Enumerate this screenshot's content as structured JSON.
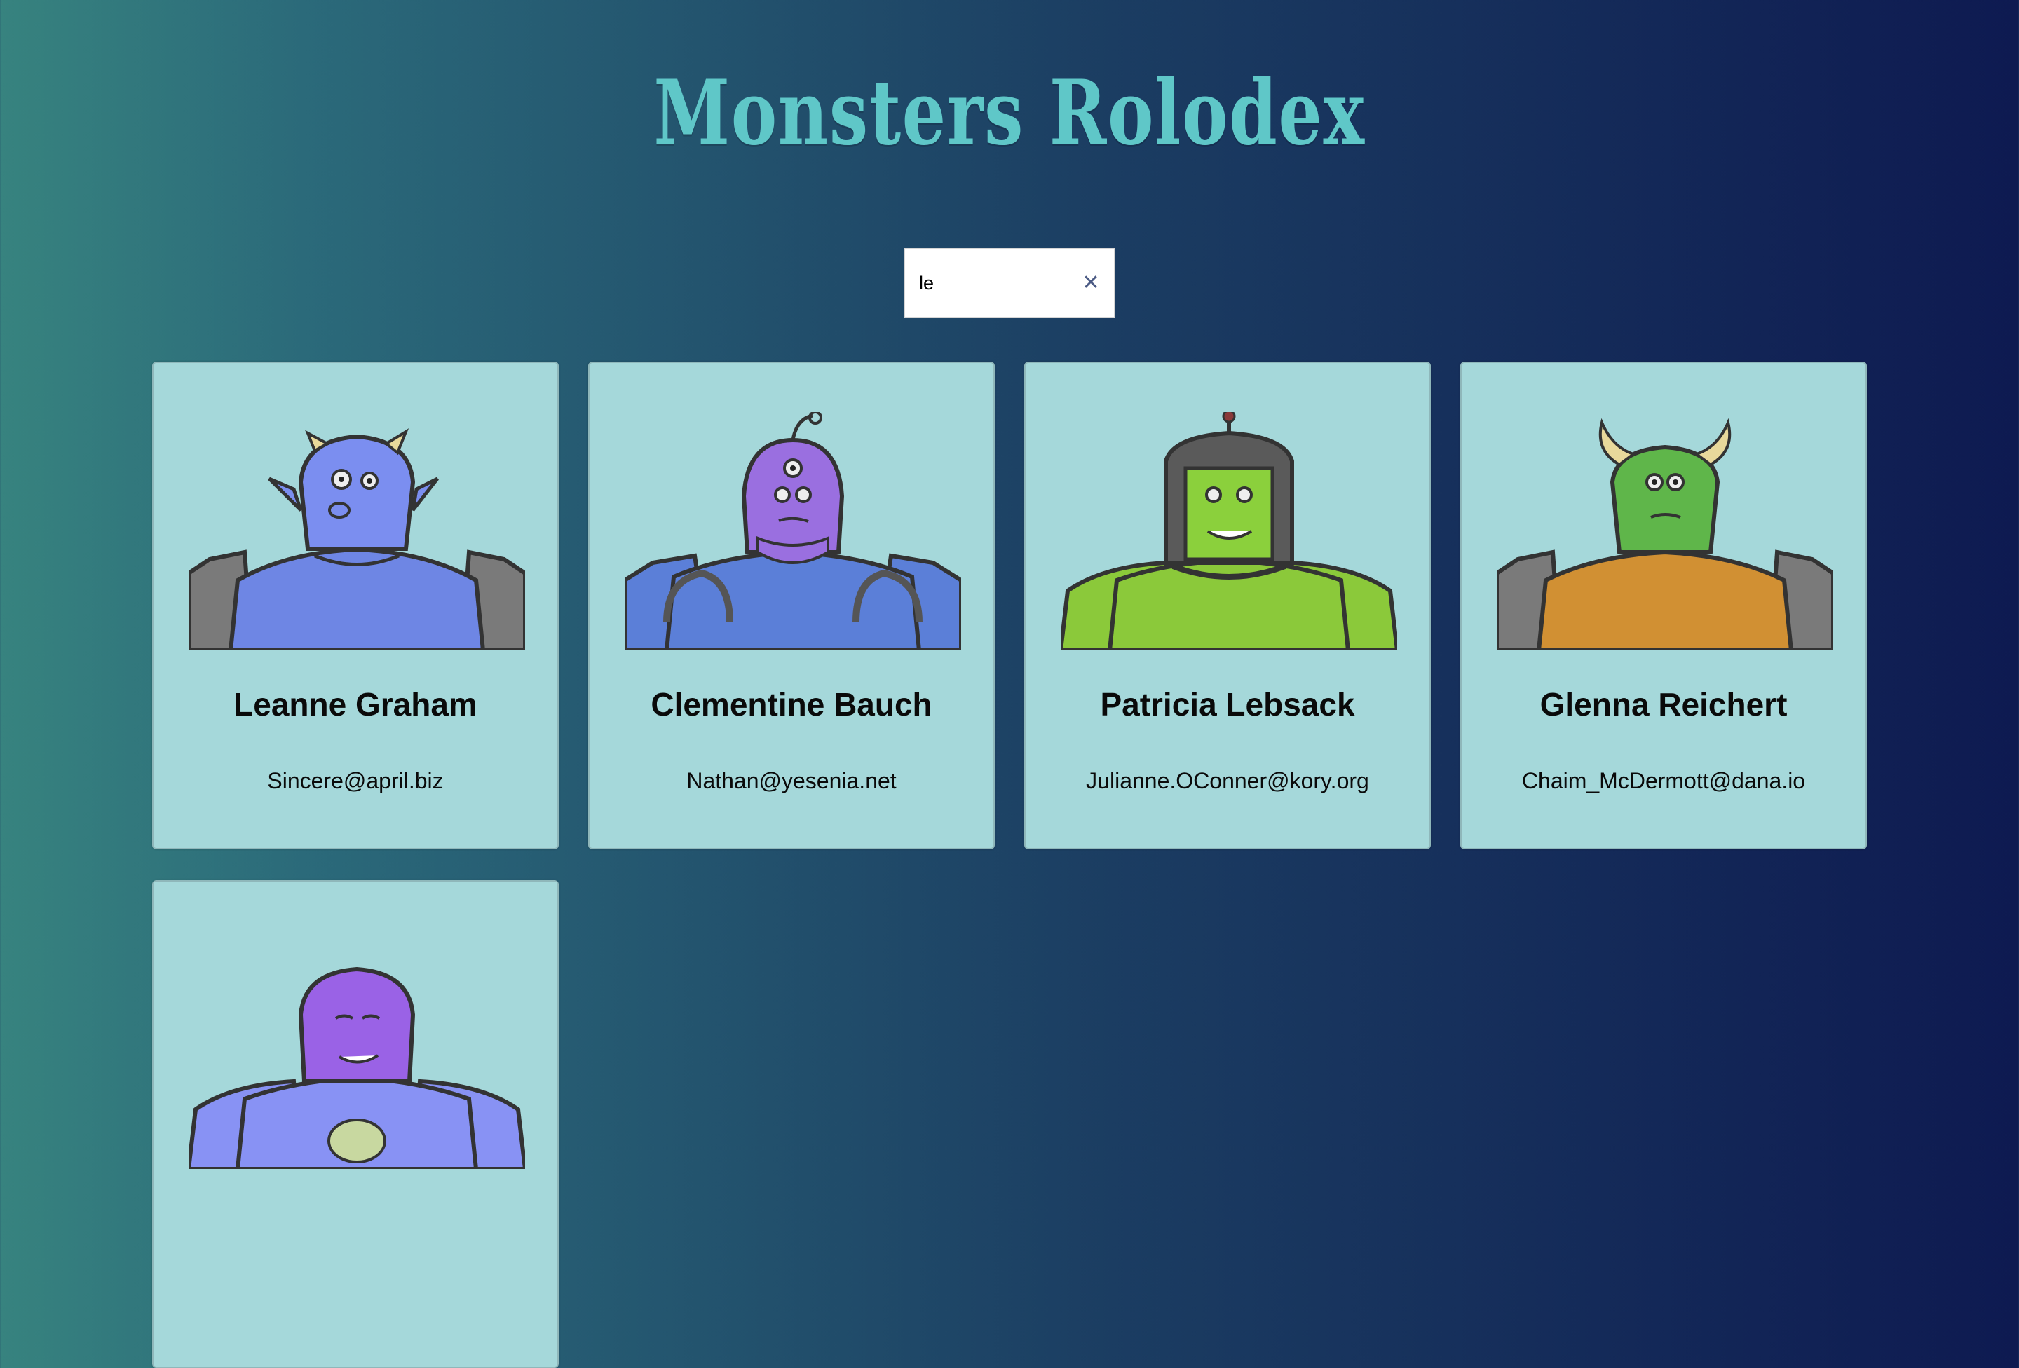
{
  "app": {
    "title": "Monsters Rolodex"
  },
  "search": {
    "value": "le",
    "clear_icon": "close-icon",
    "clear_glyph": "✕"
  },
  "monsters": [
    {
      "name": "Leanne Graham",
      "email": "Sincere@april.biz",
      "skin_color": "#7b8ef0",
      "shirt_color": "#6e86e4",
      "headgear": "small horns"
    },
    {
      "name": "Clementine Bauch",
      "email": "Nathan@yesenia.net",
      "skin_color": "#9a6fe0",
      "shirt_color": "#5b7fd8",
      "headgear": "antenna"
    },
    {
      "name": "Patricia Lebsack",
      "email": "Julianne.OConner@kory.org",
      "skin_color": "#8bd03c",
      "shirt_color": "#8bc93a",
      "headgear": "helmet"
    },
    {
      "name": "Glenna Reichert",
      "email": "Chaim_McDermott@dana.io",
      "skin_color": "#5fb64a",
      "shirt_color": "#d19033",
      "headgear": "long horns"
    },
    {
      "name": "",
      "email": "",
      "skin_color": "#9a62e6",
      "shirt_color": "#8892f4",
      "headgear": "none"
    }
  ]
}
